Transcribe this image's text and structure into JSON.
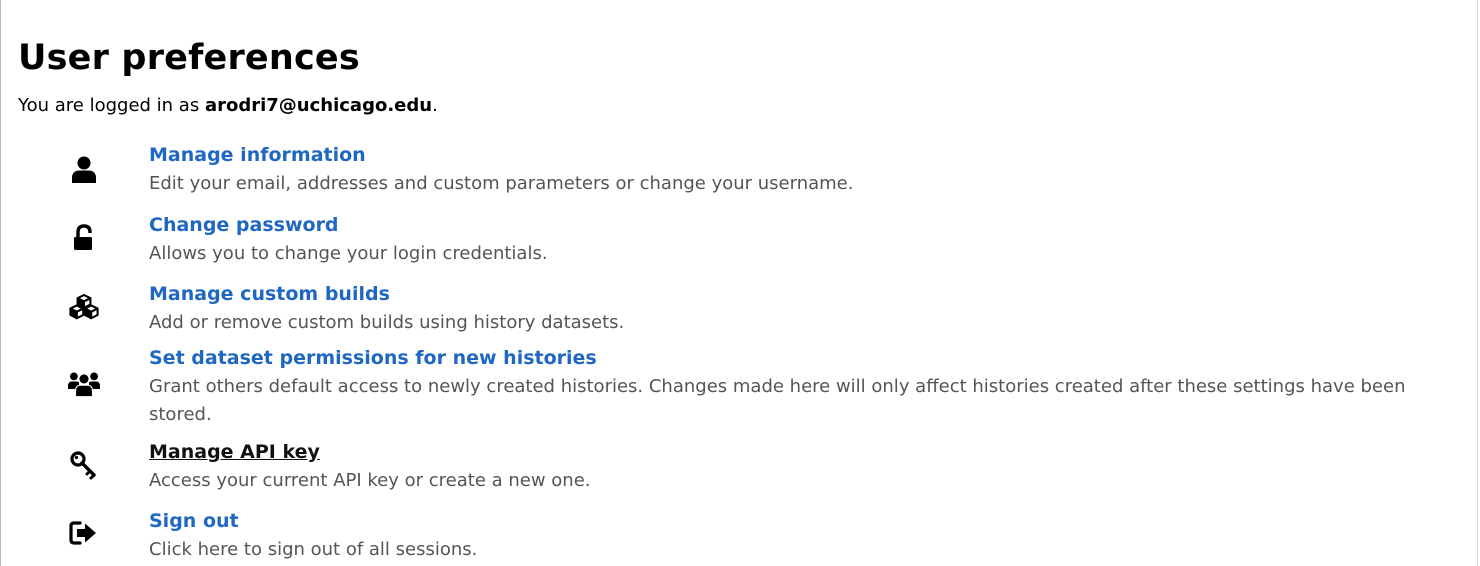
{
  "page": {
    "title": "User preferences",
    "login_prefix": "You are logged in as ",
    "user_email": "arodri7@uchicago.edu",
    "login_suffix": "."
  },
  "items": [
    {
      "icon": "user-icon",
      "title": "Manage information",
      "description": "Edit your email, addresses and custom parameters or change your username."
    },
    {
      "icon": "unlock-icon",
      "title": "Change password",
      "description": "Allows you to change your login credentials."
    },
    {
      "icon": "cubes-icon",
      "title": "Manage custom builds",
      "description": "Add or remove custom builds using history datasets."
    },
    {
      "icon": "users-icon",
      "title": "Set dataset permissions for new histories",
      "description": "Grant others default access to newly created histories. Changes made here will only affect histories created after these settings have been stored."
    },
    {
      "icon": "key-icon",
      "title": "Manage API key",
      "description": "Access your current API key or create a new one."
    },
    {
      "icon": "sign-out-icon",
      "title": "Sign out",
      "description": "Click here to sign out of all sessions."
    }
  ],
  "colors": {
    "link": "#1f67c2",
    "link_visited": "#111111",
    "description_text": "#555555"
  }
}
